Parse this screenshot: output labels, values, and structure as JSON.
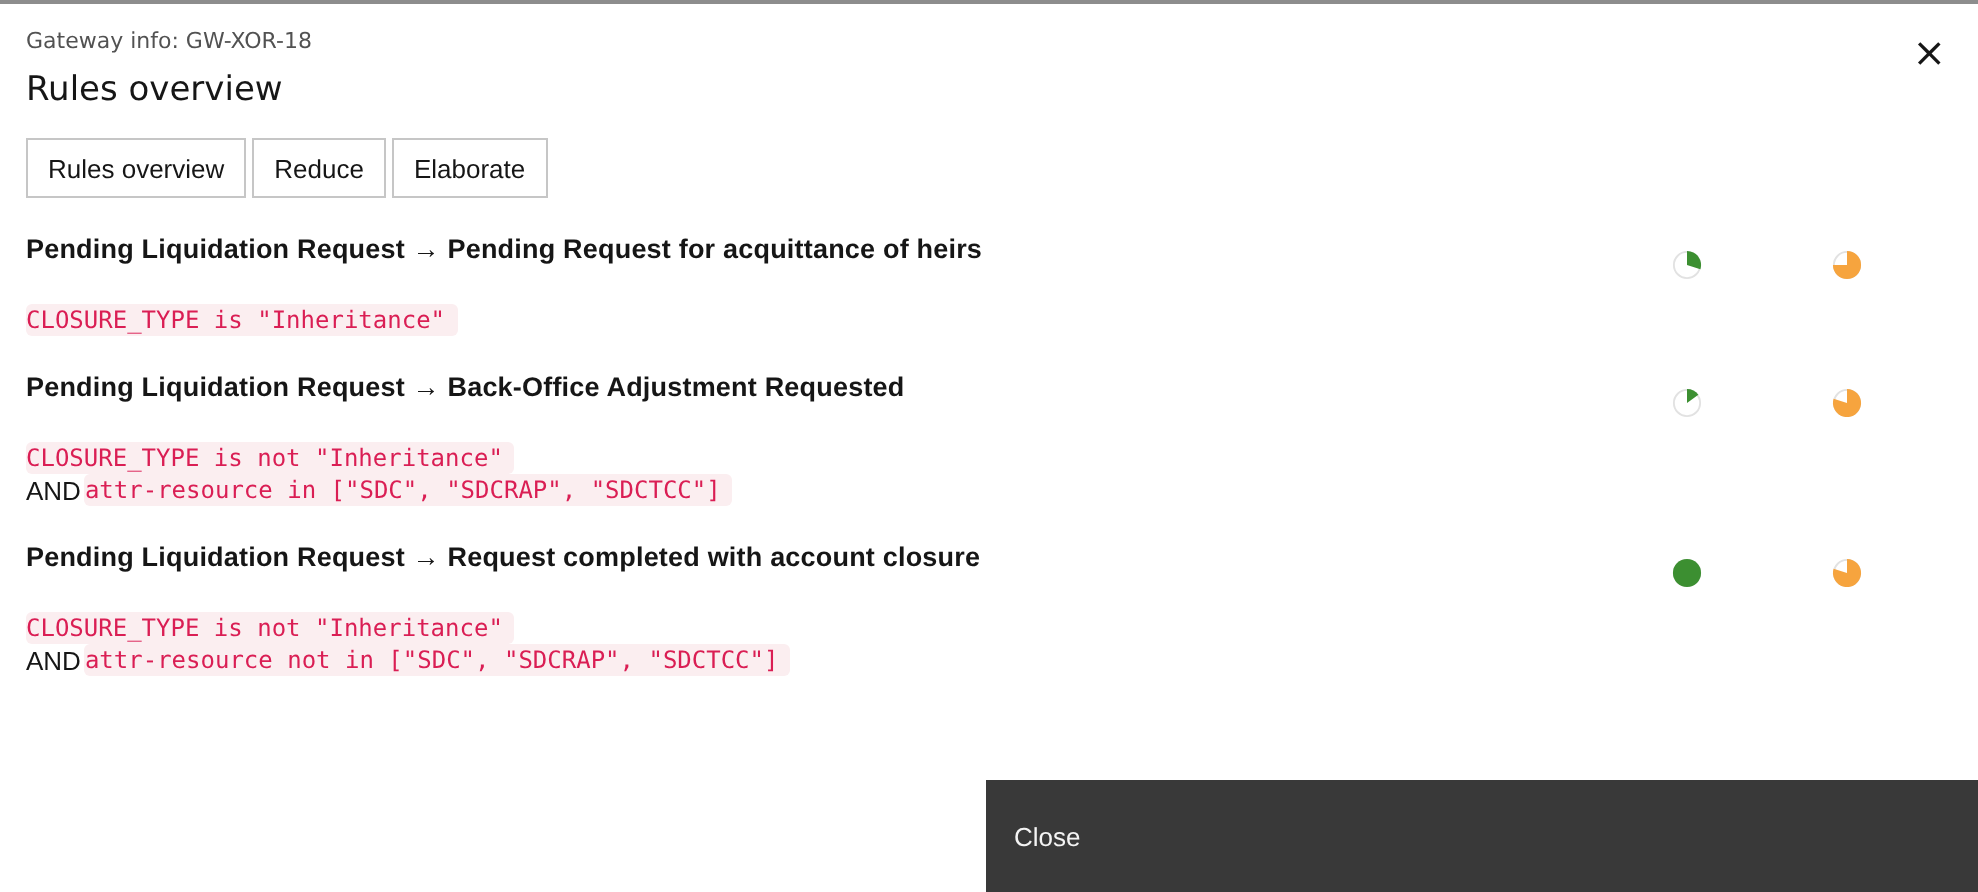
{
  "dialog": {
    "label": "Gateway info: GW-XOR-18",
    "title": "Rules overview",
    "close_icon": "×"
  },
  "tabs": [
    {
      "label": "Rules overview"
    },
    {
      "label": "Reduce"
    },
    {
      "label": "Elaborate"
    }
  ],
  "rules": [
    {
      "title": "Pending Liquidation Request → Pending Request for acquittance of heirs",
      "conditions": [
        {
          "code": "CLOSURE_TYPE is \"Inheritance\""
        }
      ],
      "meters": [
        {
          "kind": "success"
        },
        {
          "kind": "warning"
        }
      ]
    },
    {
      "title": "Pending Liquidation Request → Back-Office Adjustment Requested",
      "conditions": [
        {
          "code": "CLOSURE_TYPE is not \"Inheritance\""
        },
        {
          "operator": "AND",
          "code": "attr-resource in [\"SDC\", \"SDCRAP\", \"SDCTCC\"]"
        }
      ],
      "meters": [
        {
          "kind": "success"
        },
        {
          "kind": "warning"
        }
      ]
    },
    {
      "title": "Pending Liquidation Request → Request completed with account closure",
      "conditions": [
        {
          "code": "CLOSURE_TYPE is not \"Inheritance\""
        },
        {
          "operator": "AND",
          "code": "attr-resource not in [\"SDC\", \"SDCRAP\", \"SDCTCC\"]"
        }
      ],
      "meters": [
        {
          "kind": "success"
        },
        {
          "kind": "warning"
        }
      ]
    }
  ],
  "footer": {
    "button": "Close"
  }
}
